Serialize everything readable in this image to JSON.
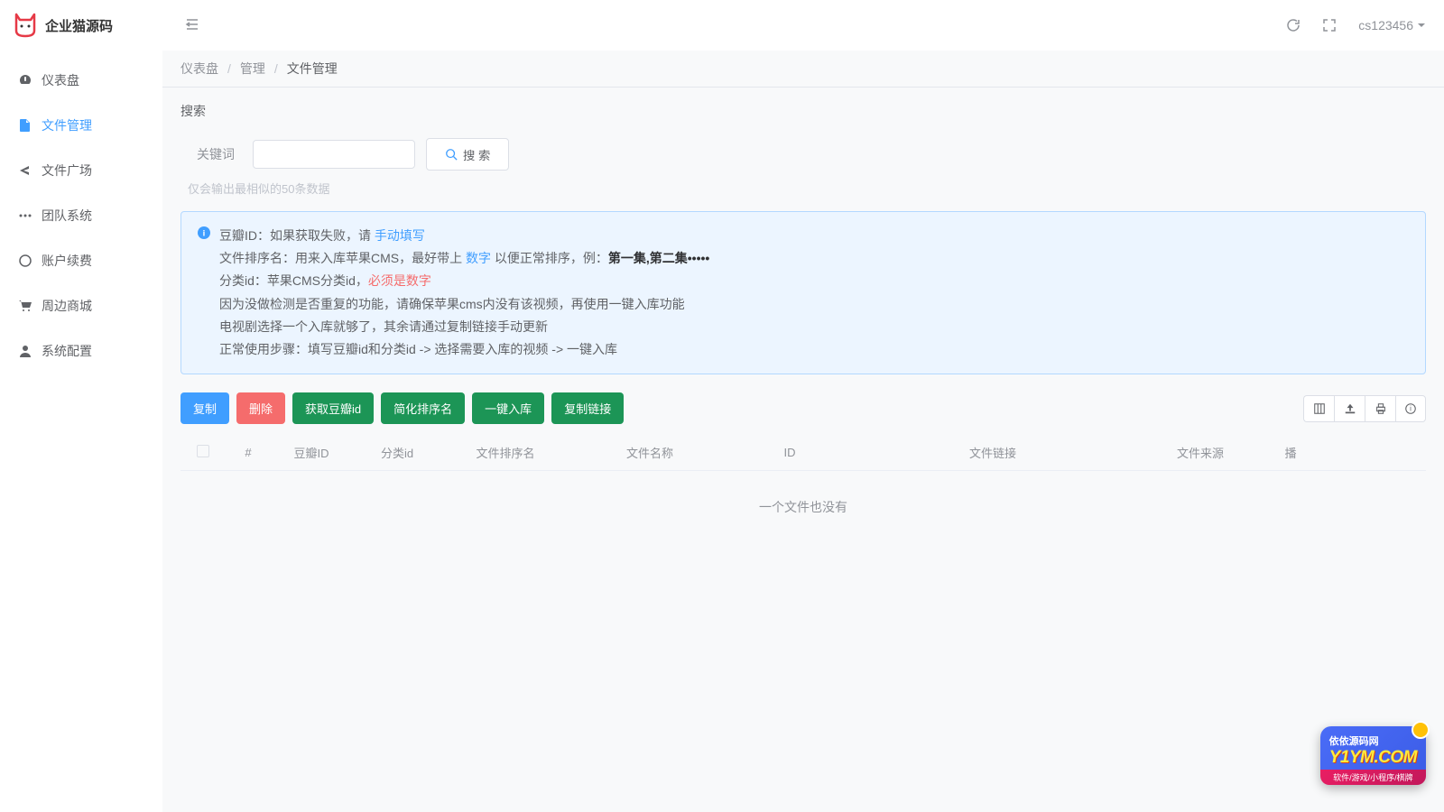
{
  "logo": {
    "text": "企业猫源码"
  },
  "header": {
    "username": "cs123456"
  },
  "sidebar": {
    "items": [
      {
        "label": "仪表盘"
      },
      {
        "label": "文件管理"
      },
      {
        "label": "文件广场"
      },
      {
        "label": "团队系统"
      },
      {
        "label": "账户续费"
      },
      {
        "label": "周边商城"
      },
      {
        "label": "系统配置"
      }
    ]
  },
  "breadcrumb": {
    "root": "仪表盘",
    "mid": "管理",
    "current": "文件管理"
  },
  "search": {
    "title": "搜索",
    "keyword_label": "关键词",
    "placeholder": "",
    "button": "搜 索",
    "hint": "仅会输出最相似的50条数据"
  },
  "info": {
    "line1_a": "豆瓣ID：如果获取失败，请 ",
    "line1_link": "手动填写",
    "line2_a": "文件排序名：用来入库苹果CMS，最好带上 ",
    "line2_link": "数字",
    "line2_b": " 以便正常排序，例：",
    "line2_bold": "第一集,第二集•••••",
    "line3_a": "分类id：苹果CMS分类id，",
    "line3_danger": "必须是数字",
    "line4": "因为没做检测是否重复的功能，请确保苹果cms内没有该视频，再使用一键入库功能",
    "line5": "电视剧选择一个入库就够了，其余请通过复制链接手动更新",
    "line6": "正常使用步骤：填写豆瓣id和分类id -> 选择需要入库的视频 -> 一键入库"
  },
  "toolbar": {
    "copy": "复制",
    "delete": "删除",
    "get_douban": "获取豆瓣id",
    "simplify": "简化排序名",
    "import": "一键入库",
    "copy_link": "复制链接"
  },
  "table": {
    "headers": {
      "hash": "#",
      "douban_id": "豆瓣ID",
      "cat_id": "分类id",
      "sort_name": "文件排序名",
      "file_name": "文件名称",
      "id": "ID",
      "link": "文件链接",
      "source": "文件来源",
      "play": "播"
    },
    "empty": "一个文件也没有"
  },
  "watermark": {
    "title": "依依源码网",
    "url": "Y1YM.COM",
    "tags": "软件/游戏/小程序/棋牌"
  }
}
